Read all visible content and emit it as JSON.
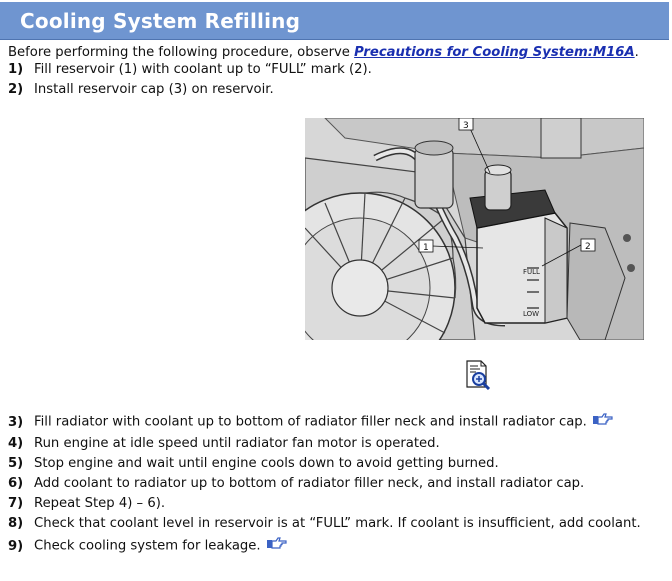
{
  "title": "Cooling System Refilling",
  "intro": {
    "text": "Before performing the following procedure, observe ",
    "link": "Precautions for Cooling System:M16A",
    "end": "."
  },
  "steps": [
    {
      "num": "1)",
      "text": "Fill reservoir (1) with coolant up to “FULL” mark (2)."
    },
    {
      "num": "2)",
      "text": "Install reservoir cap (3) on reservoir."
    },
    {
      "num": "3)",
      "text": "Fill radiator with coolant up to bottom of radiator filler neck and install radiator cap."
    },
    {
      "num": "4)",
      "text": "Run engine at idle speed until radiator fan motor is operated."
    },
    {
      "num": "5)",
      "text": "Stop engine and wait until engine cools down to avoid getting burned."
    },
    {
      "num": "6)",
      "text": "Add coolant to radiator up to bottom of radiator filler neck, and install radiator cap."
    },
    {
      "num": "7)",
      "text": "Repeat Step 4) – 6)."
    },
    {
      "num": "8)",
      "text": "Check that coolant level in reservoir is at “FULL” mark. If coolant is insufficient, add coolant."
    },
    {
      "num": "9)",
      "text": "Check cooling system for leakage."
    }
  ],
  "figure": {
    "callouts": [
      "1",
      "2",
      "3"
    ],
    "full_mark": "FULL",
    "low_mark": "LOW"
  },
  "icons": {
    "reference": "pointing-hand-icon",
    "zoom": "magnify-document-icon"
  },
  "colors": {
    "title_bar": "#6f95d0",
    "link": "#1a2fb0",
    "ref_icon": "#3b62c4"
  }
}
